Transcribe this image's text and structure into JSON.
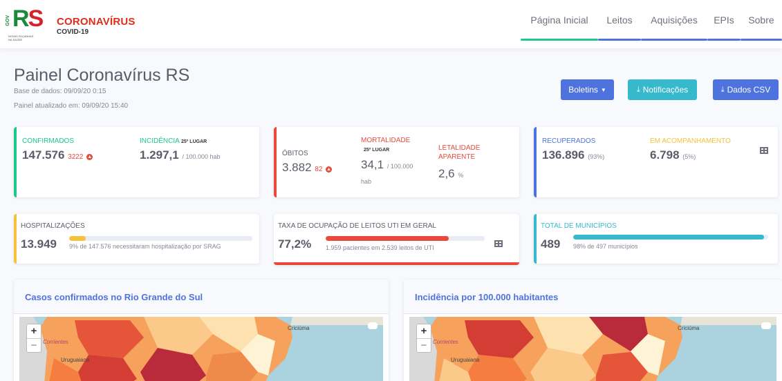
{
  "header": {
    "logo_gov": "GOV",
    "logo_rs_r": "R",
    "logo_rs_s": "S",
    "logo_tagline": "NOVAS FAÇANHAS NA SAÚDE",
    "brand_title": "CORONAVÍRUS",
    "brand_subtitle": "COVID-19",
    "nav": [
      {
        "label": "Página Inicial"
      },
      {
        "label": "Leitos"
      },
      {
        "label": "Aquisições"
      },
      {
        "label": "EPIs"
      },
      {
        "label": "Sobre"
      }
    ]
  },
  "page": {
    "title": "Painel Coronavírus RS",
    "base_dados": "Base de dados: 09/09/20 0:15",
    "atualizado": "Painel atualizado em: 09/09/20 15:40",
    "btn_boletins": "Boletins",
    "btn_notificacoes": "Notificações",
    "btn_dados_csv": "Dados CSV"
  },
  "cards": {
    "confirmados_label": "CONFIRMADOS",
    "confirmados_value": "147.576",
    "confirmados_delta": "3222",
    "incidencia_label": "INCIDÊNCIA",
    "incidencia_rank": "25º LUGAR",
    "incidencia_value": "1.297,1",
    "incidencia_unit": "/ 100.000 hab",
    "obitos_label": "ÓBITOS",
    "obitos_value": "3.882",
    "obitos_delta": "82",
    "mortalidade_label": "MORTALIDADE",
    "mortalidade_rank": "25º LUGAR",
    "mortalidade_value": "34,1",
    "mortalidade_unit": "/ 100.000",
    "mortalidade_unit2": "hab",
    "letalidade_label1": "LETALIDADE",
    "letalidade_label2": "APARENTE",
    "letalidade_value": "2,6",
    "letalidade_unit": "%",
    "recuperados_label": "RECUPERADOS",
    "recuperados_value": "136.896",
    "recuperados_pct": "(93%)",
    "acompanhamento_label": "EM ACOMPANHAMENTO",
    "acompanhamento_value": "6.798",
    "acompanhamento_pct": "(5%)",
    "hosp_label": "HOSPITALIZAÇÕES",
    "hosp_value": "13.949",
    "hosp_desc": "9% de 147.576 necessitaram hospitalização por SRAG",
    "hosp_progress": 0.09,
    "uti_label": "TAXA DE OCUPAÇÃO DE LEITOS UTI EM GERAL",
    "uti_value": "77,2%",
    "uti_desc": "1.959 pacientes em 2.539 leitos de UTI",
    "uti_progress": 0.772,
    "mun_label": "TOTAL DE MUNICÍPIOS",
    "mun_value": "489",
    "mun_desc": "98% de 497 municípios",
    "mun_progress": 0.98
  },
  "maps": {
    "left_title": "Casos confirmados no Rio Grande do Sul",
    "right_title": "Incidência por 100.000 habitantes",
    "place_corrientes": "Corrientes",
    "place_uruguaiana": "Uruguaiana",
    "place_criciuma": "Criciúma",
    "zoom_in": "+",
    "zoom_out": "−"
  },
  "colors": {
    "primary": "#4e73df",
    "success": "#1cc88a",
    "danger": "#e74a3b",
    "warning": "#f6c23e",
    "info": "#36b9cc"
  }
}
